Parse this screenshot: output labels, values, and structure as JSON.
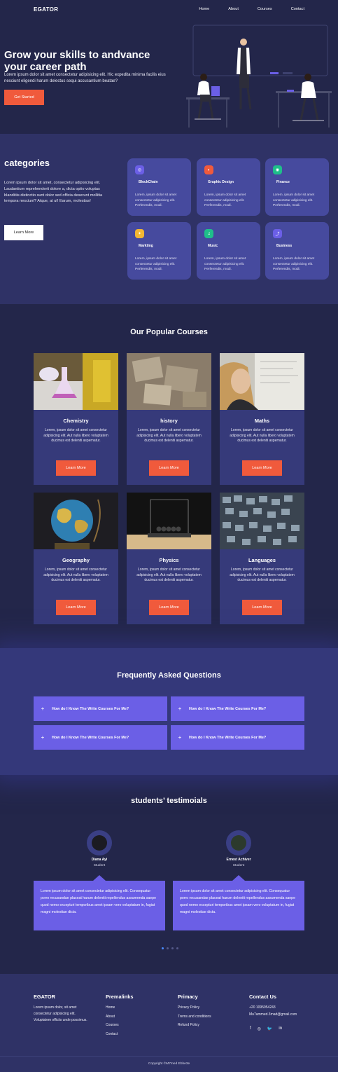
{
  "nav": {
    "logo": "EGATOR",
    "links": [
      "Home",
      "About",
      "Courses",
      "Contact"
    ]
  },
  "hero": {
    "title": "Grow your skills to andvance your career path",
    "text": "Lorem ipsum dolor sit amet consectetur adipisicing elit. Hic expedita minima facilis eius nesciunt eligendi harum delectus sequi accusantium beatae?",
    "button": "Get Started"
  },
  "categories": {
    "title": "categories",
    "text": "Lorem ipsum dolor sit amet, consectetur adipisicing elit. Laudantium reprehenderit dolore a, dicta optio voluptas blanditiis distinctio sunt dolor sed officia deserunt mollitia tempora nesciunt? Atque, at ut! Earum, molestias!",
    "button": "Learn More",
    "items": [
      {
        "name": "BlockChain",
        "desc": "Lorem, ipsum dolor sit amet consectetur adipisicing elit. Perferendis, modi.",
        "color": "#6b5fe6",
        "icon": "◎"
      },
      {
        "name": "Graphic Design",
        "desc": "Lorem, ipsum dolor sit amet consectetur adipisicing elit. Perferendis, modi.",
        "color": "#f05a3c",
        "icon": "◐"
      },
      {
        "name": "Finance",
        "desc": "Lorem, ipsum dolor sit amet consectetur adipisicing elit. Perferendis, modi.",
        "color": "#1fbf8a",
        "icon": "◉"
      },
      {
        "name": "Markting",
        "desc": "Lorem, ipsum dolor sit amet consectetur adipisicing elit. Perferendis, modi.",
        "color": "#f2b632",
        "icon": "✦"
      },
      {
        "name": "Music",
        "desc": "Lorem, ipsum dolor sit amet consectetur adipisicing elit. Perferendis, modi.",
        "color": "#1fbf8a",
        "icon": "♫"
      },
      {
        "name": "Business",
        "desc": "Lorem, ipsum dolor sit amet consectetur adipisicing elit. Perferendis, modi.",
        "color": "#6b5fe6",
        "icon": "⤴"
      }
    ]
  },
  "courses": {
    "title": "Our Popular Courses",
    "button": "Learn More",
    "items": [
      {
        "name": "Chemistry",
        "desc": "Lorem, ipsum dolor sit amet consectetur adipisicing elit. Aut nulla libero voluptatem ducimus est deleniti aspernatur."
      },
      {
        "name": "history",
        "desc": "Lorem, ipsum dolor sit amet consectetur adipisicing elit. Aut nulla libero voluptatem ducimus est deleniti aspernatur."
      },
      {
        "name": "Maths",
        "desc": "Lorem, ipsum dolor sit amet consectetur adipisicing elit. Aut nulla libero voluptatem ducimus est deleniti aspernatur."
      },
      {
        "name": "Geography",
        "desc": "Lorem, ipsum dolor sit amet consectetur adipisicing elit. Aut nulla libero voluptatem ducimus est deleniti aspernatur."
      },
      {
        "name": "Physics",
        "desc": "Lorem, ipsum dolor sit amet consectetur adipisicing elit. Aut nulla libero voluptatem ducimus est deleniti aspernatur."
      },
      {
        "name": "Languages",
        "desc": "Lorem, ipsum dolor sit amet consectetur adipisicing elit. Aut nulla libero voluptatem ducimus est deleniti aspernatur."
      }
    ]
  },
  "faq": {
    "title": "Frequently Asked Questions",
    "items": [
      "How do I Know The Write Courses For Me?",
      "How do I Know The Write Courses For Me?",
      "How do I Know The Write Courses For Me?",
      "How do I Know The Write Courses For Me?"
    ]
  },
  "testimonials": {
    "title": "students’ testimoials",
    "items": [
      {
        "name": "Diana Ayi",
        "role": "Student",
        "text": "Lorem ipsum dolor sit amet consectetur adipisicing elit. Consequatur porro recusandae placeat harum deleniti repellendus assumenda saepe quod nemo excepturi temporibus amet ipsam vero voluptatum in, fugiat magni molestiae dicta."
      },
      {
        "name": "Ernest Achiver",
        "role": "Student",
        "text": "Lorem ipsum dolor sit amet consectetur adipisicing elit. Consequatur porro recusandae placeat harum deleniti repellendus assumenda saepe quod nemo excepturi temporibus amet ipsam vero voluptatum in, fugiat magni molestiae dicta."
      }
    ]
  },
  "footer": {
    "logo": "EGATOR",
    "about": "Lorem ipsum dolor, sit amet consectetur adipisicing elit. Voluptatem officiis unde possimus.",
    "permalinks_title": "Premalinks",
    "permalinks": [
      "Home",
      "About",
      "Courses",
      "Contact"
    ],
    "primacy_title": "Primacy",
    "primacy": [
      "Privacy Policy",
      "Trems and conditions",
      "Refund Policy"
    ],
    "contact_title": "Contact Us",
    "phone": "+20 1095954243",
    "email": "Mu7ammed.3mad@gmail.com",
    "social": [
      "f",
      "◎",
      "🐦",
      "in"
    ],
    "copyright": "Copyright ©M7med Ebbe3e"
  }
}
